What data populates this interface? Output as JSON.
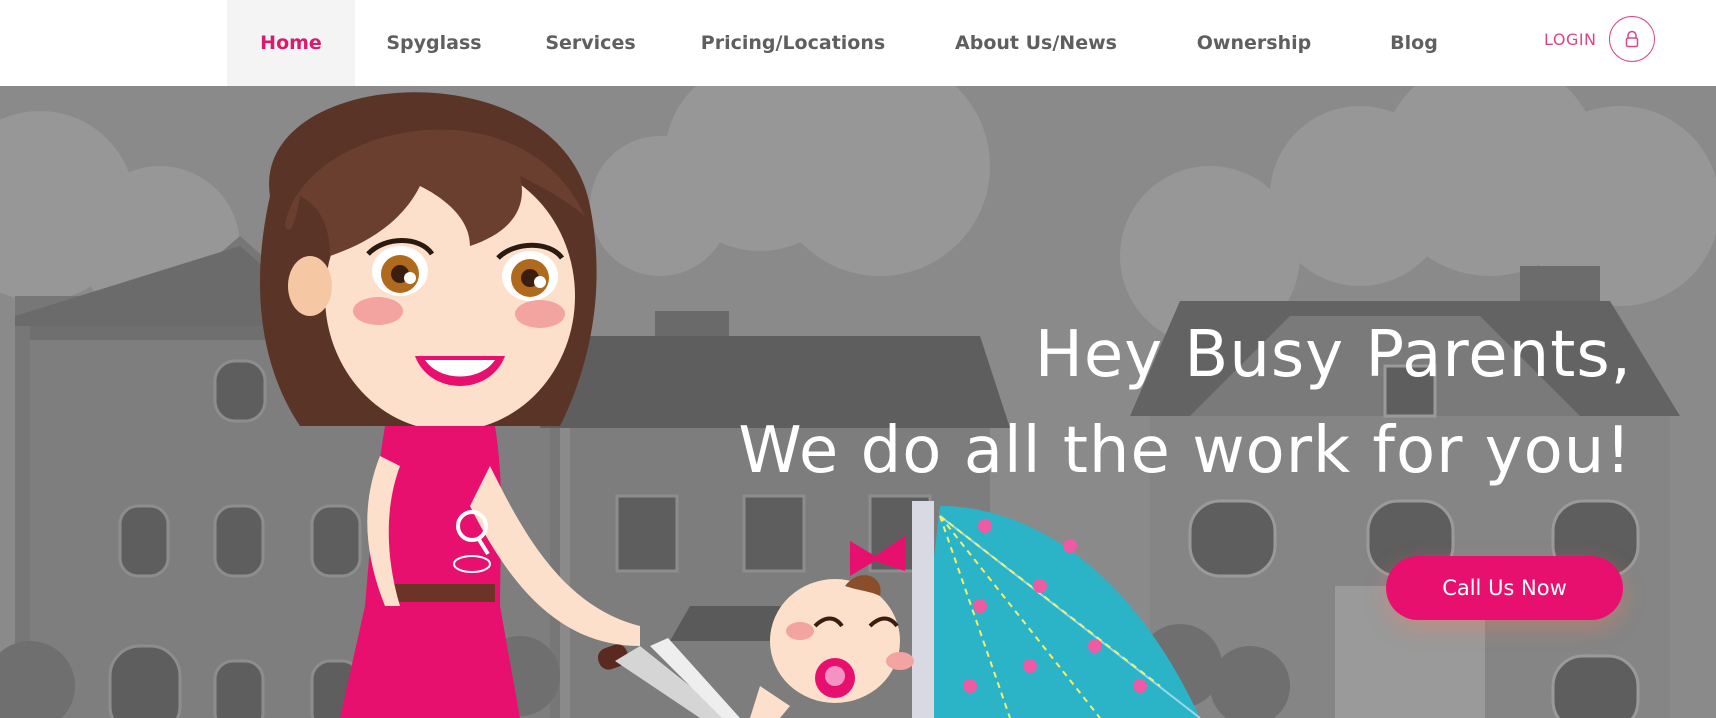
{
  "nav": {
    "items": [
      {
        "label": "Home",
        "active": true
      },
      {
        "label": "Spyglass"
      },
      {
        "label": "Services"
      },
      {
        "label": "Pricing/Locations"
      },
      {
        "label": "About Us/News"
      },
      {
        "label": "Ownership"
      },
      {
        "label": "Blog"
      }
    ],
    "login_label": "LOGIN",
    "login_icon": "lock-icon"
  },
  "hero": {
    "line1": "Hey Busy Parents,",
    "line2": "We do all the work for you!",
    "cta_label": "Call Us Now"
  },
  "colors": {
    "accent": "#e8106f",
    "active_nav": "#d81b6e",
    "nav_text": "#5f5f5f",
    "hero_overlay": "#8a8a8a",
    "stroller_teal": "#2bb3c8"
  }
}
